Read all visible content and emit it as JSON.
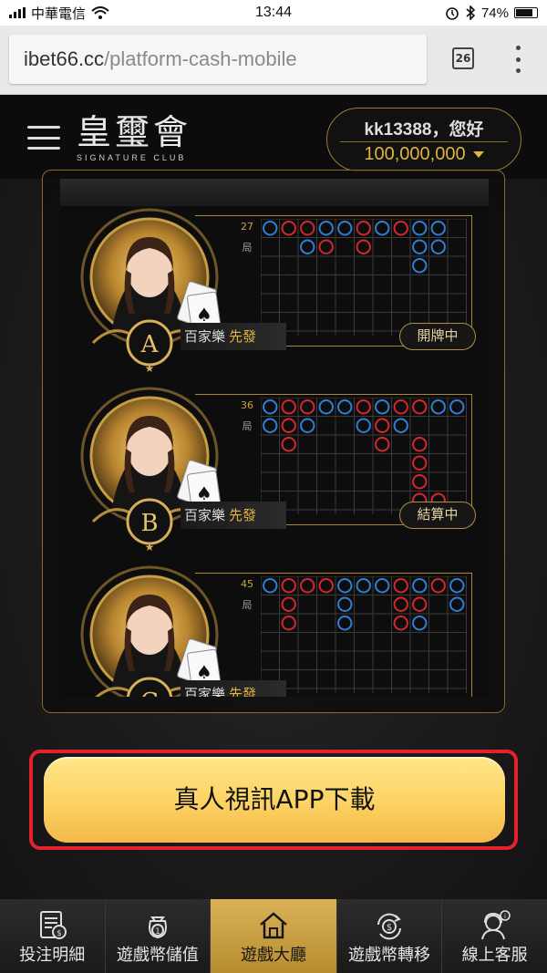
{
  "status_bar": {
    "carrier": "中華電信",
    "time": "13:44",
    "battery": "74%"
  },
  "browser": {
    "url_host": "ibet66.cc",
    "url_path": "/platform-cash-mobile",
    "tab_count": "26"
  },
  "header": {
    "logo_text": "皇璽會",
    "logo_subtitle": "SIGNATURE CLUB",
    "greeting": "kk13388，您好",
    "balance": "100,000,000"
  },
  "tables": [
    {
      "letter": "A",
      "game": "百家樂",
      "dealer_tag": "先發",
      "status": "開牌中",
      "count": "27",
      "rounds_label": "局",
      "road": [
        [
          "B",
          "R",
          "R",
          "B",
          "B",
          "R",
          "B",
          "R",
          "B",
          "B"
        ],
        [
          "",
          "",
          "B",
          "R",
          "",
          "R",
          "",
          "",
          "B",
          "B"
        ],
        [
          "",
          "",
          "",
          "",
          "",
          "",
          "",
          "",
          "B",
          ""
        ]
      ]
    },
    {
      "letter": "B",
      "game": "百家樂",
      "dealer_tag": "先發",
      "status": "結算中",
      "count": "36",
      "rounds_label": "局",
      "road": [
        [
          "B",
          "R",
          "R",
          "B",
          "B",
          "R",
          "B",
          "R",
          "R",
          "B",
          "B"
        ],
        [
          "B",
          "R",
          "B",
          "",
          "",
          "B",
          "R",
          "B",
          "",
          "",
          ""
        ],
        [
          "",
          "R",
          "",
          "",
          "",
          "",
          "R",
          "",
          "R",
          "",
          ""
        ],
        [
          "",
          "",
          "",
          "",
          "",
          "",
          "",
          "",
          "R",
          "",
          ""
        ],
        [
          "",
          "",
          "",
          "",
          "",
          "",
          "",
          "",
          "R",
          "",
          ""
        ],
        [
          "",
          "",
          "",
          "",
          "",
          "",
          "",
          "",
          "R",
          "R",
          ""
        ]
      ]
    },
    {
      "letter": "C",
      "game": "百家樂",
      "dealer_tag": "先發",
      "status": "",
      "count": "45",
      "rounds_label": "局",
      "road": [
        [
          "B",
          "R",
          "R",
          "R",
          "B",
          "B",
          "B",
          "R",
          "B",
          "R",
          "B"
        ],
        [
          "",
          "R",
          "",
          "",
          "B",
          "",
          "",
          "R",
          "R",
          "",
          "B"
        ],
        [
          "",
          "R",
          "",
          "",
          "B",
          "",
          "",
          "R",
          "B",
          "",
          ""
        ]
      ]
    }
  ],
  "download_button": "真人視訊APP下載",
  "nav": [
    {
      "label": "投注明細",
      "icon": "bet-record-icon"
    },
    {
      "label": "遊戲幣儲值",
      "icon": "coin-deposit-icon"
    },
    {
      "label": "遊戲大廳",
      "icon": "home-icon"
    },
    {
      "label": "遊戲幣轉移",
      "icon": "coin-transfer-icon"
    },
    {
      "label": "線上客服",
      "icon": "customer-service-icon"
    }
  ],
  "colors": {
    "gold": "#e2b33e",
    "banker_red": "#d8262f",
    "player_blue": "#2f7fd6",
    "highlight_red": "#e3222b"
  }
}
